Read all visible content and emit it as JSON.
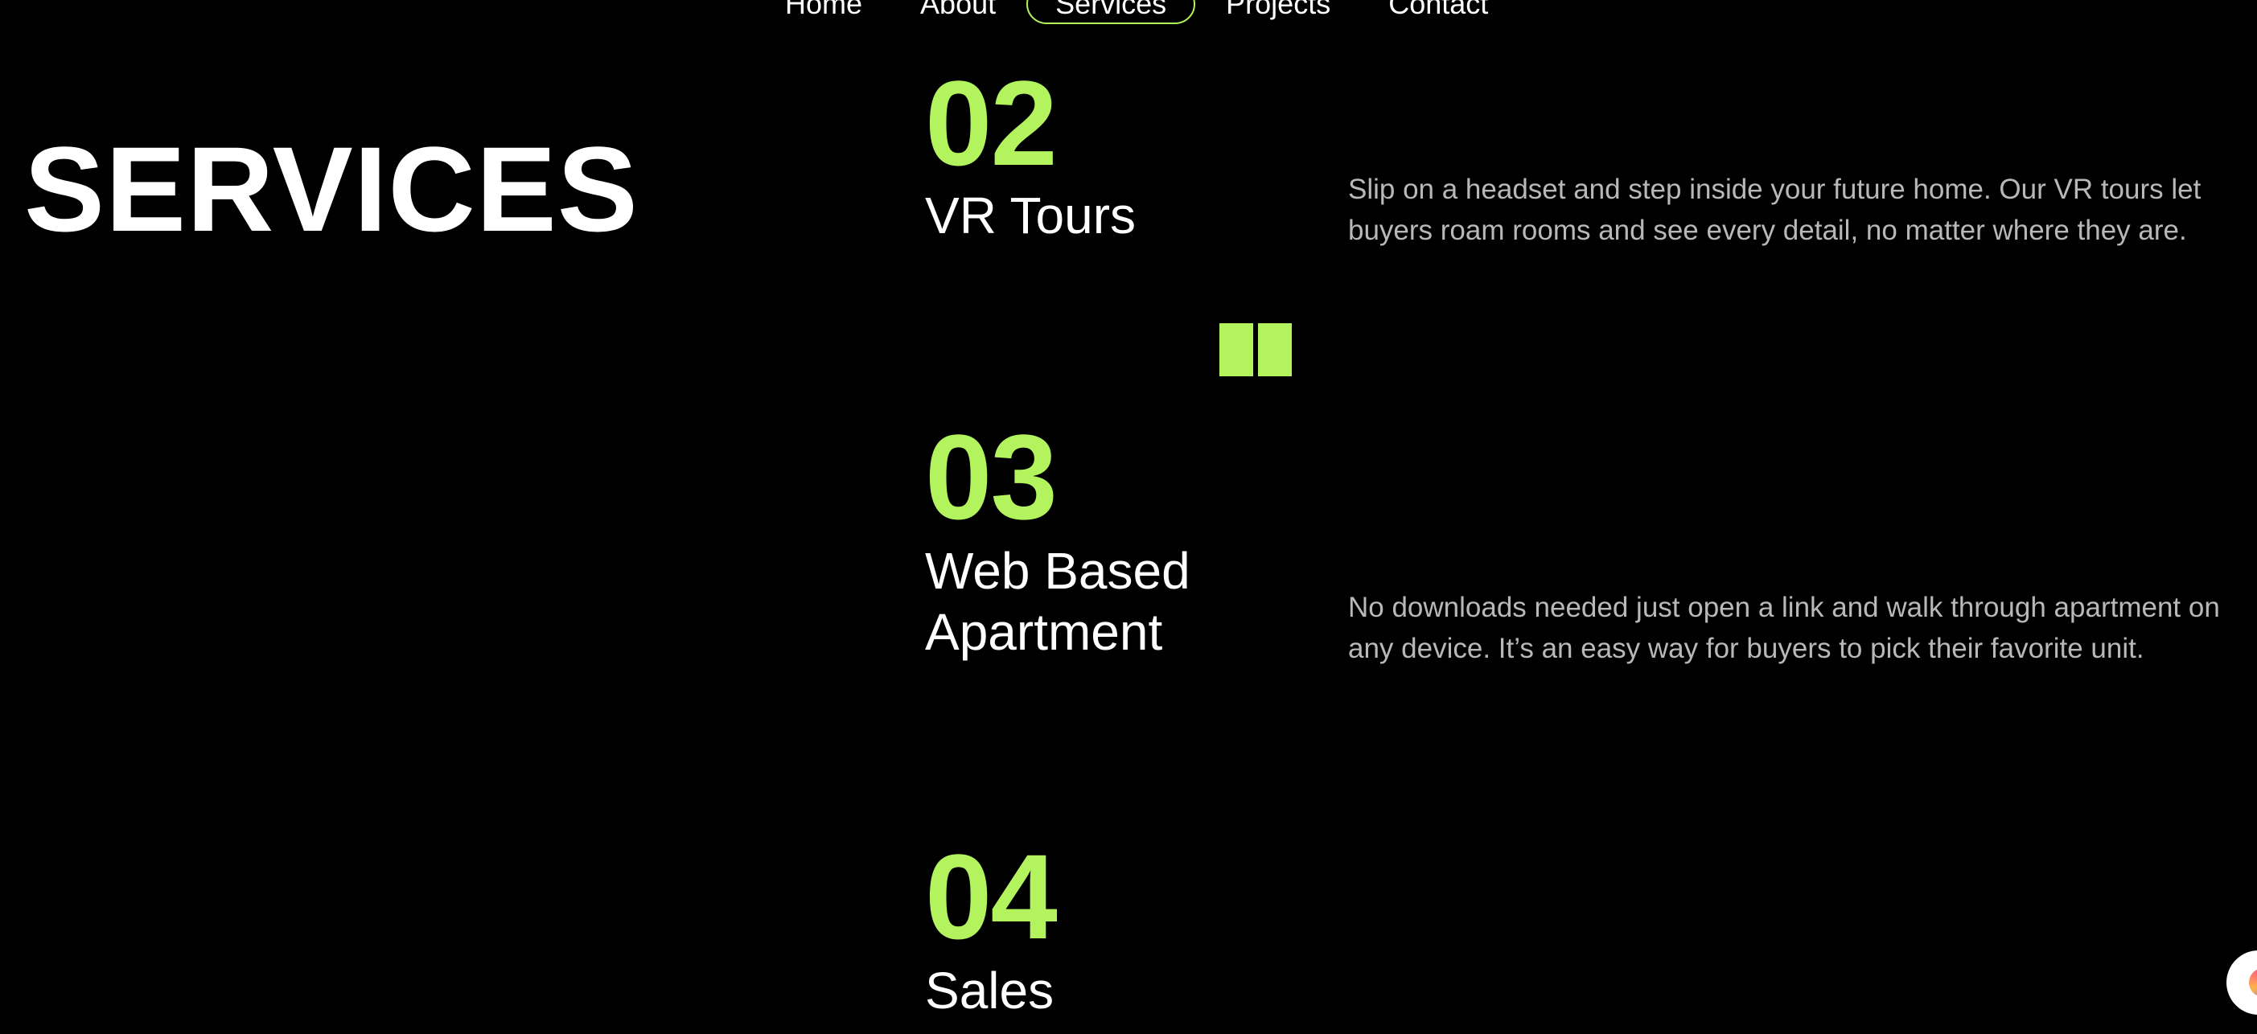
{
  "nav": {
    "items": [
      {
        "label": "Home"
      },
      {
        "label": "About"
      },
      {
        "label": "Services"
      },
      {
        "label": "Projects"
      },
      {
        "label": "Contact"
      }
    ],
    "active": "Services"
  },
  "page": {
    "title": "SERVICES"
  },
  "services": [
    {
      "number": "02",
      "name": "VR Tours",
      "description": "Slip on a headset and step inside your future home. Our VR tours let buyers roam rooms and see every detail, no matter where they are."
    },
    {
      "number": "03",
      "name_line1": "Web Based",
      "name_line2": "Apartment",
      "description": "No downloads needed just open a link and walk through apartment on any device. It’s an easy way for buyers to pick their favorite unit."
    },
    {
      "number": "04",
      "name": "Sales"
    }
  ],
  "icons": {
    "decor": "book-icon",
    "chat": "chat-widget-icon"
  },
  "colors": {
    "accent": "#b2f35e",
    "background": "#000000",
    "text": "#ffffff",
    "muted_text": "#b8b8b8"
  }
}
